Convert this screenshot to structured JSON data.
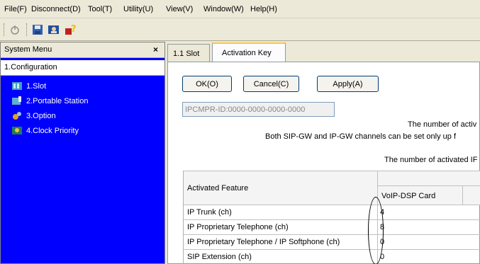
{
  "menubar": {
    "items": [
      "File(F)",
      "Disconnect(D)",
      "Tool(T)",
      "Utility(U)",
      "View(V)",
      "Window(W)",
      "Help(H)"
    ]
  },
  "toolbar": {
    "buttons": [
      "connect-icon",
      "save-icon",
      "user-icon",
      "help-icon"
    ]
  },
  "left_panel": {
    "title": "System Menu",
    "close": "×",
    "section": "1.Configuration",
    "items": [
      "1.Slot",
      "2.Portable Station",
      "3.Option",
      "4.Clock Priority"
    ]
  },
  "tabs": [
    {
      "label": "1.1 Slot",
      "active": false
    },
    {
      "label": "Activation Key",
      "active": true
    }
  ],
  "buttons": {
    "ok": "OK(O)",
    "cancel": "Cancel(C)",
    "apply": "Apply(A)"
  },
  "id_field": {
    "value": "IPCMPR-ID:0000-0000-0000-0000"
  },
  "notes": [
    "The number of activ",
    "Both SIP-GW and IP-GW channels can be set only up f",
    "The number of activated IF"
  ],
  "table": {
    "header": {
      "feature": "Activated Feature",
      "col": "VoIP-DSP Card"
    },
    "rows": [
      {
        "feature": "IP Trunk (ch)",
        "value": "4"
      },
      {
        "feature": "IP Proprietary Telephone (ch)",
        "value": "8"
      },
      {
        "feature": "IP Proprietary Telephone / IP Softphone (ch)",
        "value": "0"
      },
      {
        "feature": "SIP Extension (ch)",
        "value": "0"
      }
    ]
  },
  "colors": {
    "tree_background": "#0000ff",
    "window_background": "#ece9d8",
    "active_tab_accent": "#ffc83c"
  }
}
